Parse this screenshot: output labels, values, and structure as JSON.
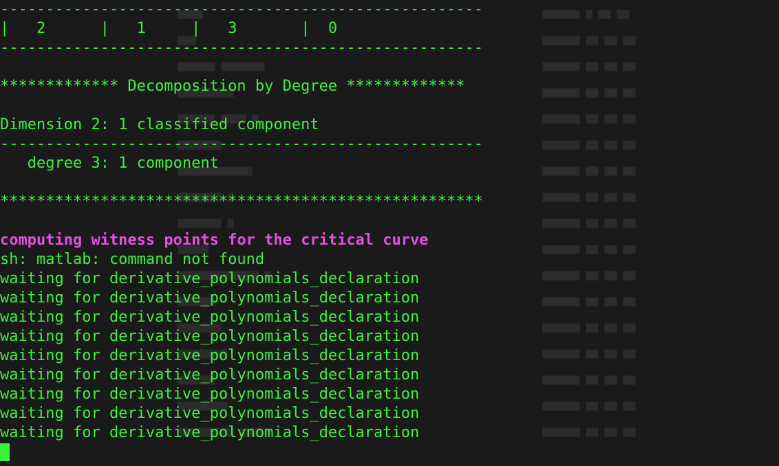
{
  "terminal": {
    "lines": [
      "-----------------------------------------------------",
      "|   2      |   1     |   3       |  0",
      "-----------------------------------------------------",
      "",
      "************* Decomposition by Degree *************",
      "",
      "Dimension 2: 1 classified component",
      "-----------------------------------------------------",
      "   degree 3: 1 component",
      "",
      "*****************************************************",
      "",
      "computing witness points for the critical curve",
      "sh: matlab: command not found",
      "waiting for derivative_polynomials_declaration",
      "waiting for derivative_polynomials_declaration",
      "waiting for derivative_polynomials_declaration",
      "waiting for derivative_polynomials_declaration",
      "waiting for derivative_polynomials_declaration",
      "waiting for derivative_polynomials_declaration",
      "waiting for derivative_polynomials_declaration",
      "waiting for derivative_polynomials_declaration",
      "waiting for derivative_polynomials_declaration"
    ]
  },
  "colors": {
    "background": "#1a1a1a",
    "text_green": "#3cf23c",
    "text_magenta": "#e34fe3",
    "cursor": "#3cf23c"
  }
}
